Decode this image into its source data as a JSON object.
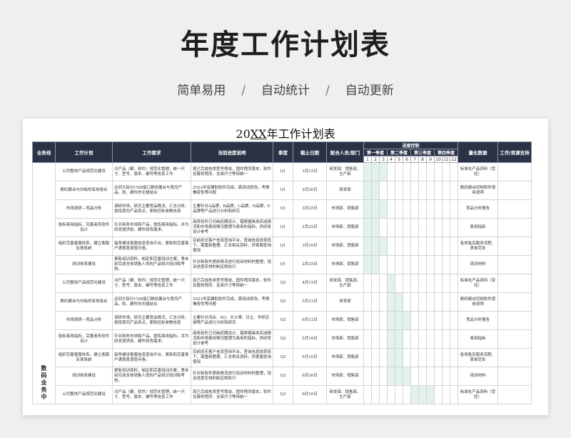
{
  "hero": {
    "title": "年度工作计划表",
    "subtitle": [
      "简单易用",
      "自动统计",
      "自动更新"
    ],
    "separator": "/"
  },
  "sheet": {
    "title_prefix": "20",
    "title_xx": "XX",
    "title_suffix": "年工作计划表",
    "headers": [
      "业务线",
      "工作计划",
      "工作要求",
      "当前进度说明",
      "季度",
      "截止日期",
      "配合人员/部门",
      "进度控制",
      "量化数据",
      "工作/资源支持"
    ],
    "quarters": [
      "第一季度",
      "第二季度",
      "第三季度",
      "第四季度"
    ],
    "months": [
      "1",
      "2",
      "3",
      "4",
      "5",
      "6",
      "7",
      "8",
      "9",
      "10",
      "11",
      "12"
    ],
    "business_line": "数码业务中",
    "highlight_color": "#e3f1ef",
    "header_color": "#2b3246",
    "rows": [
      {
        "plan": "公司整体产品规范化建设",
        "req": "对产品（硬、软件）规范化管理，统一尺寸、型号、版本、编号等信息工作",
        "progress": "现已完成核类型号筛选，固件程序版本，软件及服务程序、支架尺寸等待统一",
        "q": "Q1",
        "date": "3月15日",
        "team": "研发部、销售部、生产部",
        "quant": "标准化产品资料（受控）",
        "months": [
          1,
          2,
          3
        ]
      },
      {
        "plan": "数码展台与白板的有效组合",
        "req": "达到大部分USB接口数码展台与我司产品，软、硬件的无缝结合",
        "progress": "2022年底辅助软件完成，需测试修改，考察兼容性等问题",
        "q": "Q1",
        "date": "2月20日",
        "team": "研发部",
        "quant": "数码展台控制软件使用说明",
        "months": [
          1,
          2
        ]
      },
      {
        "plan": "市场调研—竞品分析",
        "req": "调研市场，研究主要竞品情况，汇总分析，提炼我司产品卖点，更新控标参数信息",
        "progress": "主要针对A品牌，B品牌，C品牌，D品牌，E品牌等产品进行分析和研究",
        "q": "Q1",
        "date": "3月25日",
        "team": "市场部、销售部",
        "quant": "竞品分析报告",
        "months": [
          1,
          2,
          3
        ]
      },
      {
        "plan": "投标易用指标，完善商务软件设计",
        "req": "针对商务市场和产品，提炼易用指标，并为研发提供软、硬件修改需求。",
        "progress": "商务软件已归纳初期设计，需根据具体实成情况和市场使用情况整理为易用的指标，供研发设计参考",
        "q": "Q1",
        "date": "2月25日",
        "team": "市场部、销售部",
        "quant": "易用指标",
        "months": [
          1,
          2
        ]
      },
      {
        "plan": "组织完善客服体系，建立客服反馈系统",
        "req": "指导建设客服信息查询平台，更新和完善客户满意度调查问卷。",
        "progress": "目前尚无客户信息查询平台，查询信息效率低下，需重新整理、汇总相关资料，供客服查询使用",
        "q": "Q1",
        "date": "3月16日",
        "team": "市场部、销售部",
        "quant": "各类售后服务流程、表单范本",
        "months": [
          1,
          2,
          3
        ]
      },
      {
        "plan": "培训体系建设",
        "req": "更新培训资料，制定和完善培训方案，季末前完成全体销售人员的产品知识培训和考核。",
        "progress": "针对新软件更新情况进行培训材料的整理，培训进度安排的制定和执行",
        "q": "Q1",
        "date": "2月25日",
        "team": "市场部、销售部",
        "quant": "培训材料",
        "months": [
          1,
          2
        ]
      },
      {
        "plan": "公司整体产品规范化建设",
        "req": "对产品（硬、软件）规范化管理，统一尺寸、型号、版本、编号等信息工作",
        "progress": "现已完成核类型号筛选，固件程序版本，软件及服务程序、支架尺寸等待统一",
        "q": "Q2",
        "date": "4月15日",
        "team": "研发部、销售部、生产部",
        "quant": "标准化产品资料（受控）",
        "months": [
          4
        ]
      },
      {
        "plan": "数码展台与白板的有效组合",
        "req": "达到大部分USB接口数码展台与我司产品，软、硬件的无缝结合",
        "progress": "2022年底辅助软件完成，需测试修改，考察兼容性等问题",
        "q": "Q2",
        "date": "5月31日",
        "team": "研发部",
        "quant": "数码展台控制软件使用说明",
        "months": [
          4,
          5
        ]
      },
      {
        "plan": "市场调研—竞品分析",
        "req": "调研市场，研究主要竞品情况，汇总分析，提炼我司产品卖点，更新控标参数信息",
        "progress": "主要针对鸿合、SQ、天士博、日立、华师京城等产品进行分析和研究",
        "q": "Q2",
        "date": "6月12日",
        "team": "市场部、销售部",
        "quant": "竞品分析报告",
        "months": [
          4,
          5,
          6
        ]
      },
      {
        "plan": "投标易用指标，完善商务软件设计",
        "req": "针对商务市场和产品，提炼易用指标，并为研发提供软、硬件修改需求。",
        "progress": "商务软件已归纳初期设计，需根据具体实成情况和市场使用情况整理为易用的指标，供研发设计参考",
        "q": "Q2",
        "date": "5月16日",
        "team": "市场部、销售部",
        "quant": "易用指标",
        "months": [
          4,
          5
        ]
      },
      {
        "plan": "组织完善客服体系，建立客服反馈系统",
        "req": "指导建设客服信息查询平台，更新和完善客户满意度调查问卷。",
        "progress": "目前尚无客户信息查询平台，查询信息效率低下，需重新整理、汇总相关资料，供客服查询使用",
        "q": "Q2",
        "date": "5月10日",
        "team": "市场部、销售部",
        "quant": "各类售后服务流程、表单范本",
        "months": [
          4,
          5
        ]
      },
      {
        "plan": "培训体系建设",
        "req": "更新培训资料，制定和完善培训方案，季末前完成全体销售人员的产品知识培训和考核。",
        "progress": "针对新软件更新情况进行培训材料的整理，培训进度安排的制定和执行",
        "q": "Q2",
        "date": "6月30日",
        "team": "市场部、销售部",
        "quant": "培训材料",
        "months": [
          4,
          5,
          6
        ]
      },
      {
        "plan": "公司整体产品规范化建设",
        "req": "对产品（硬、软件）规范化管理，统一尺寸、型号、版本、编号等信息工作",
        "progress": "现已完成核类型号筛选，固件程序版本，软件及服务程序、支架尺寸等待统一",
        "q": "Q3",
        "date": "9月10日",
        "team": "研发部、销售部、生产部",
        "quant": "标准化产品资料（受控）",
        "months": [
          7,
          8,
          9
        ]
      }
    ]
  }
}
